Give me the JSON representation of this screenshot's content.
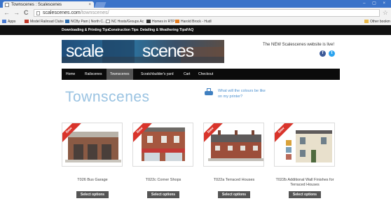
{
  "browser": {
    "tab_title": "Townscenes : Scalescenes",
    "tab_close": "×",
    "window_controls": "– ▢ ×",
    "nav": {
      "back": "←",
      "forward": "→",
      "reload": "C"
    },
    "url_host": "scalescenes.com",
    "url_path": "/townscenes/",
    "star": "☆",
    "bookmarks": [
      {
        "label": "Apps",
        "color": "#4a7bd1"
      },
      {
        "label": "Model Railroad Clubs",
        "color": "#c0392b"
      },
      {
        "label": "NCBy Pam | North C...",
        "color": "#2f6fb0"
      },
      {
        "label": "NC Hosts/Groups Ac",
        "color": "#888888"
      },
      {
        "label": "Homes in RTP",
        "color": "#333333"
      },
      {
        "label": "Harold Brock - Hudl",
        "color": "#e67e22"
      }
    ],
    "other_bookmarks": "Other bookm"
  },
  "topnav": [
    "Downloading & Printing Tips",
    "Construction Tips",
    "Detailing & Weathering Tips",
    "FAQ"
  ],
  "header": {
    "logo_left": "scale",
    "logo_right": "scenes",
    "announcement": "The NEW Scalescenes website is live!",
    "social": [
      {
        "icon": "facebook-icon",
        "glyph": "f",
        "color": "#3b5998"
      },
      {
        "icon": "twitter-icon",
        "glyph": "t",
        "color": "#2aa3ef"
      }
    ]
  },
  "mainnav": [
    {
      "label": "Home",
      "active": false
    },
    {
      "label": "Railscenes",
      "active": false
    },
    {
      "label": "Townscenes",
      "active": true
    },
    {
      "label": "Scratchbuilder's yard",
      "active": false
    },
    {
      "label": "Cart",
      "active": false
    },
    {
      "label": "Checkout",
      "active": false
    }
  ],
  "page": {
    "title": "Townscenes",
    "print_link": "What will the colours be like on my printer?"
  },
  "products": [
    {
      "ribbon": "New",
      "name": "T026 Bus Garage",
      "button": "Select options"
    },
    {
      "ribbon": "New",
      "name": "T022c Corner Shops",
      "button": "Select options"
    },
    {
      "ribbon": "New",
      "name": "T022a Terraced Houses",
      "button": "Select options"
    },
    {
      "ribbon": "New",
      "name": "T022b Additional Wall Finishes for Terraced Houses",
      "button": "Select options"
    }
  ]
}
